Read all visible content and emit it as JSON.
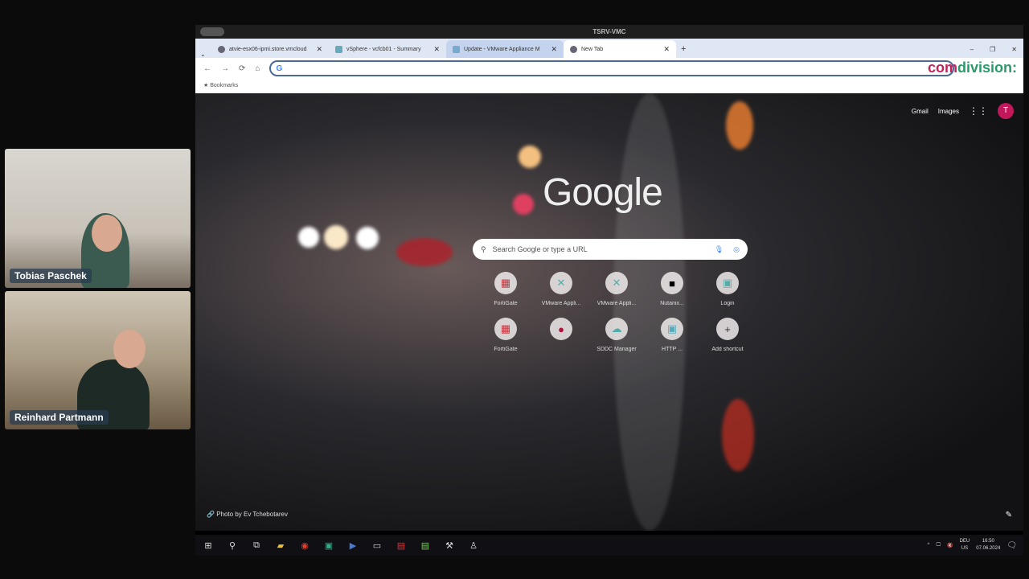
{
  "participants": [
    {
      "name": "Tobias Paschek"
    },
    {
      "name": "Reinhard Partmann"
    }
  ],
  "window": {
    "title": "TSRV-VMC"
  },
  "tabs": [
    {
      "label": "atvie-esx06-ipmi.store.vmcloud",
      "active": false
    },
    {
      "label": "vSphere - vcfcb01 - Summary",
      "active": false
    },
    {
      "label": "Update - VMware Appliance M",
      "active": false
    },
    {
      "label": "New Tab",
      "active": true
    }
  ],
  "omnibox": {
    "value": ""
  },
  "bookmarks": {
    "label": "Bookmarks"
  },
  "brand": {
    "left": "com",
    "right": "division:"
  },
  "ntp": {
    "gmail": "Gmail",
    "images": "Images",
    "avatar": "T",
    "logo": "Google",
    "search_placeholder": "Search Google or type a URL",
    "shortcuts": [
      {
        "label": "FortiGate",
        "icon": "fortigate-icon",
        "glyph": "▦",
        "color": "#c8303a"
      },
      {
        "label": "VMware Appli...",
        "icon": "vmware-icon",
        "glyph": "✕",
        "color": "#5aa"
      },
      {
        "label": "VMware Appli...",
        "icon": "vmware-icon",
        "glyph": "✕",
        "color": "#5aa"
      },
      {
        "label": "Nutanix...",
        "icon": "nutanix-icon",
        "glyph": "■",
        "color": "#000"
      },
      {
        "label": "Login",
        "icon": "login-icon",
        "glyph": "▣",
        "color": "#5aa"
      },
      {
        "label": "FortiGate",
        "icon": "fortigate-icon",
        "glyph": "▦",
        "color": "#c8303a"
      },
      {
        "label": "",
        "icon": "app-icon",
        "glyph": "●",
        "color": "#b0103a"
      },
      {
        "label": "SDDC Manager",
        "icon": "cloud-icon",
        "glyph": "☁",
        "color": "#5aa"
      },
      {
        "label": "HTTP ...",
        "icon": "page-icon",
        "glyph": "▣",
        "color": "#5ab"
      },
      {
        "label": "Add shortcut",
        "icon": "plus-icon",
        "glyph": "+",
        "color": "#333"
      }
    ],
    "credit": "Photo by Ev Tchebotarev"
  },
  "taskbar": {
    "lang1": "DEU",
    "lang2": "US",
    "time": "16:50",
    "date": "07.06.2024"
  }
}
